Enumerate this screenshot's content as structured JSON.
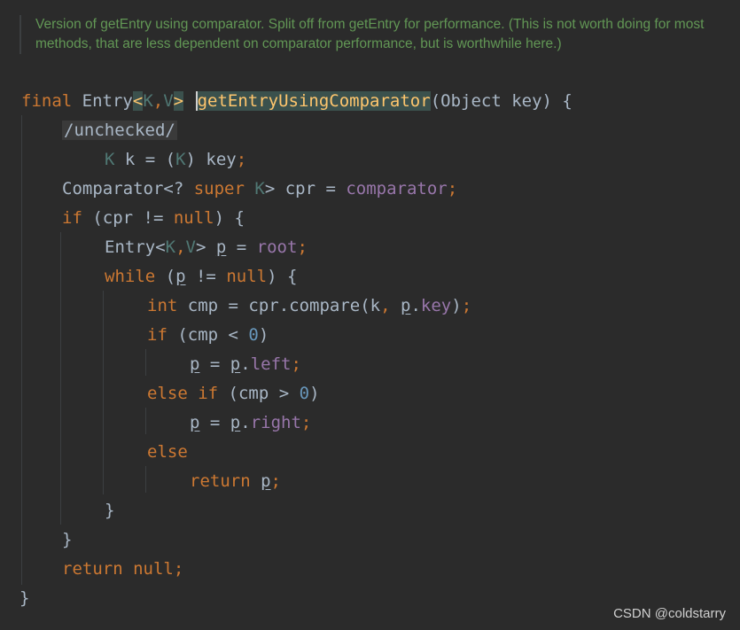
{
  "doc_comment": "Version of getEntry using comparator. Split off from getEntry for performance. (This is not worth doing for most methods, that are less dependent on comparator performance, but is worthwhile here.)",
  "code": {
    "l1": {
      "final": "final",
      "entry": "Entry",
      "lt": "<",
      "k": "K",
      "comma": ",",
      "v": "V",
      "gt": ">",
      "method": "getEntryUsingComparator",
      "params": "(Object key) {"
    },
    "l2": {
      "annotation": "/unchecked/"
    },
    "l3": {
      "k": "K",
      "rest1": " k = (",
      "k2": "K",
      "rest2": ") key",
      "semi": ";"
    },
    "l4": {
      "comparator": "Comparator<? ",
      "super": "super",
      "sp": " ",
      "k": "K",
      "rest": "> cpr = ",
      "field": "comparator",
      "semi": ";"
    },
    "l5": {
      "if": "if",
      "rest1": " (cpr != ",
      "null": "null",
      "rest2": ") {"
    },
    "l6": {
      "entry": "Entry<",
      "k": "K",
      "comma": ",",
      "v": "V",
      "rest1": "> ",
      "p": "p",
      "rest2": " = ",
      "root": "root",
      "semi": ";"
    },
    "l7": {
      "while": "while",
      "rest1": " (",
      "p": "p",
      "rest2": " != ",
      "null": "null",
      "rest3": ") {"
    },
    "l8": {
      "int": "int",
      "rest1": " cmp = cpr.compare(k",
      "comma": ",",
      "sp": " ",
      "p": "p",
      "dot": ".",
      "key": "key",
      "rest2": ")",
      "semi": ";"
    },
    "l9": {
      "if": "if",
      "rest1": " (cmp < ",
      "zero": "0",
      "rest2": ")"
    },
    "l10": {
      "p": "p",
      "rest1": " = ",
      "p2": "p",
      "dot": ".",
      "left": "left",
      "semi": ";"
    },
    "l11": {
      "else": "else",
      "sp": " ",
      "if": "if",
      "rest1": " (cmp > ",
      "zero": "0",
      "rest2": ")"
    },
    "l12": {
      "p": "p",
      "rest1": " = ",
      "p2": "p",
      "dot": ".",
      "right": "right",
      "semi": ";"
    },
    "l13": {
      "else": "else"
    },
    "l14": {
      "return": "return",
      "sp": " ",
      "p": "p",
      "semi": ";"
    },
    "l15": {
      "brace": "}"
    },
    "l16": {
      "brace": "}"
    },
    "l17": {
      "return": "return",
      "sp": " ",
      "null": "null",
      "semi": ";"
    },
    "l18": {
      "brace": "}"
    }
  },
  "watermark": "CSDN @coldstarry"
}
